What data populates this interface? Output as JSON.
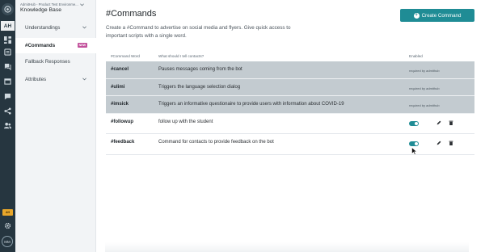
{
  "rail": {
    "user_initials": "AH",
    "badge_text": "AH",
    "avatar_initials": "MM",
    "icons": [
      "admithub-logo-icon",
      "dashboard-icon",
      "knowledge-base-icon",
      "conversations-icon",
      "calendar-icon",
      "messages-icon",
      "share-icon",
      "people-icon",
      "settings-icon"
    ]
  },
  "sidebar": {
    "org_name": "AdmitHub - Product Test Environme...",
    "section_title": "Knowledge Base",
    "items": [
      {
        "label": "Understandings"
      },
      {
        "label": "#Commands",
        "badge": "NEW"
      },
      {
        "label": "Fallback Responses"
      },
      {
        "label": "Attributes"
      }
    ]
  },
  "main": {
    "title": "#Commands",
    "create_button": "Create Command",
    "description": "Create a #Command to advertise on social media and flyers. Give quick access to important scripts with a single word.",
    "columns": {
      "word": "#Command Word",
      "contacts": "What should I tell contacts?",
      "enabled": "Enabled"
    },
    "rows": [
      {
        "word": "#cancel",
        "contacts": "Pauses messages coming from the bot",
        "status": "required by admithub"
      },
      {
        "word": "#ulimi",
        "contacts": "Triggers the language selection dialog",
        "status": "required by admithub"
      },
      {
        "word": "#imsick",
        "contacts": "Triggers an informative questionaire to provide users with information about COVID-19",
        "status": "required by admithub"
      },
      {
        "word": "#followup",
        "contacts": "follow up with the student",
        "enabled": true
      },
      {
        "word": "#feedback",
        "contacts": "Command for contacts to provide feedback on the bot",
        "enabled": true
      }
    ]
  },
  "colors": {
    "accent": "#1f8c95",
    "rail": "#263640",
    "required_row": "#c3cbd0",
    "new_badge": "#c2509b"
  }
}
